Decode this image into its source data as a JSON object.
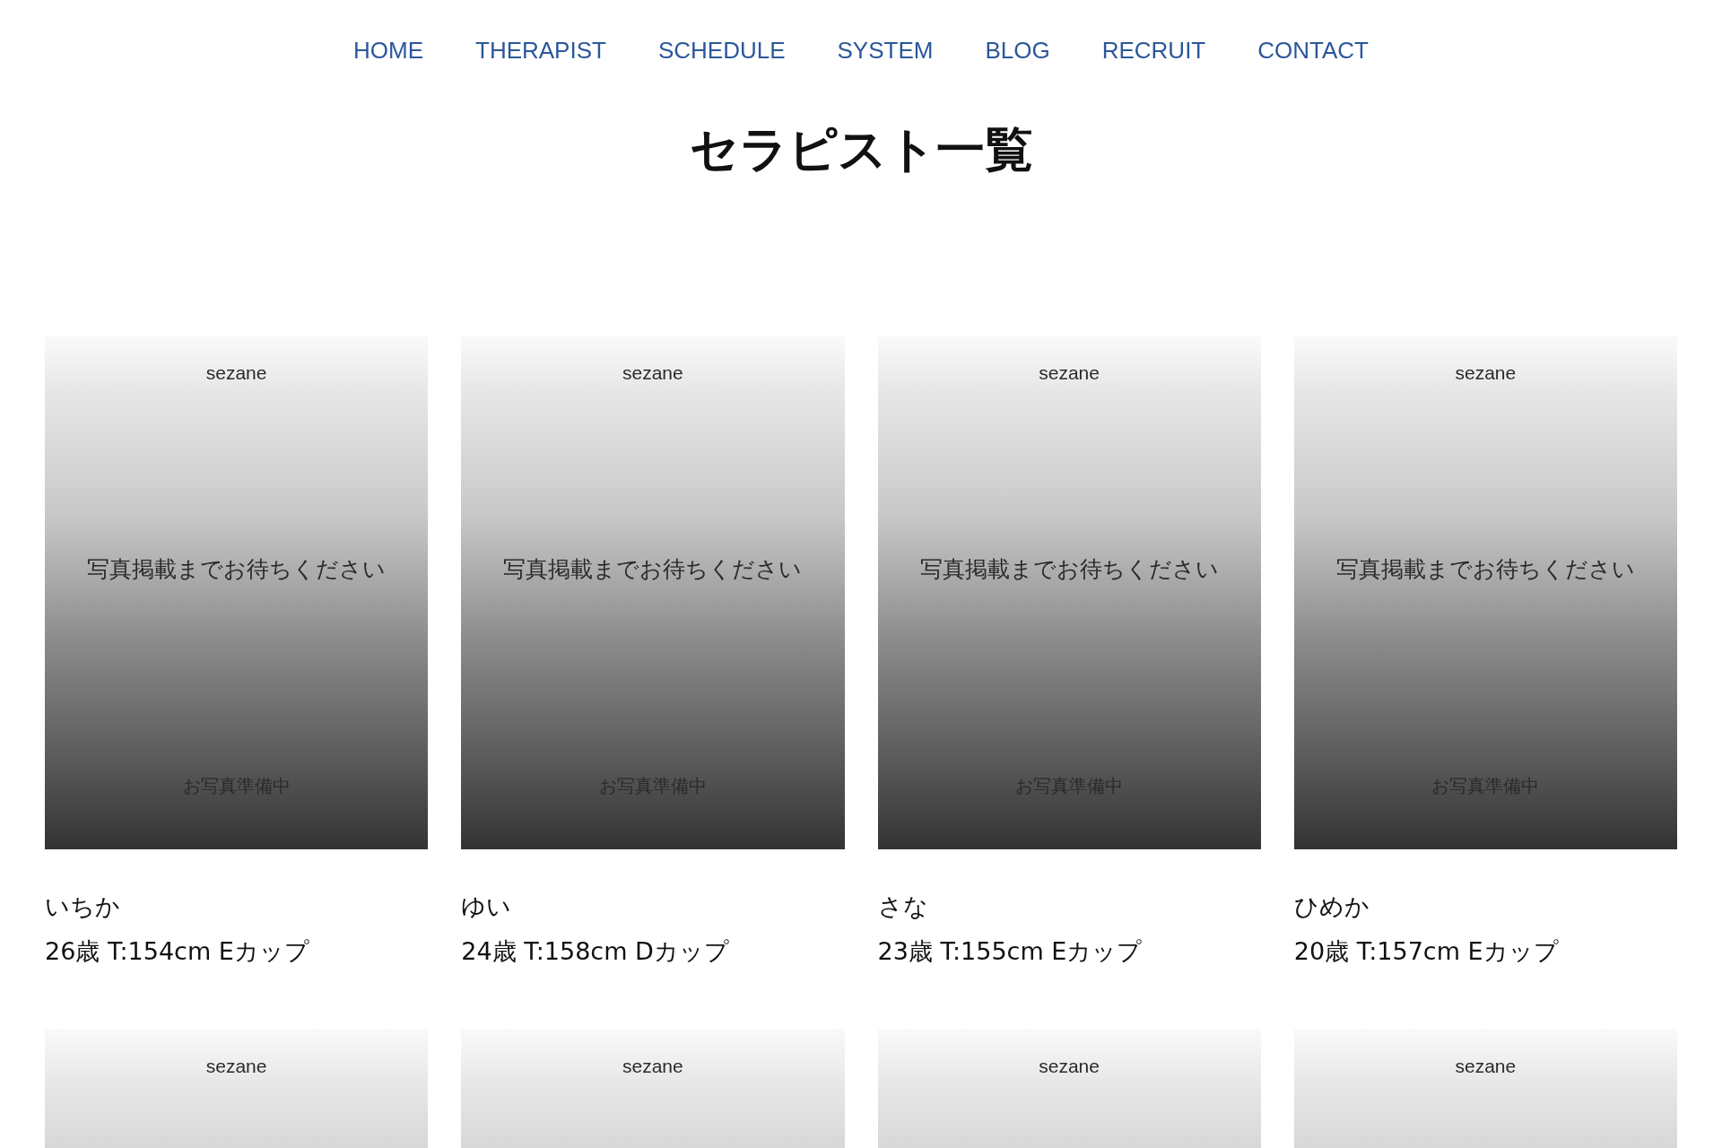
{
  "nav": [
    {
      "label": "HOME"
    },
    {
      "label": "THERAPIST"
    },
    {
      "label": "SCHEDULE"
    },
    {
      "label": "SYSTEM"
    },
    {
      "label": "BLOG"
    },
    {
      "label": "RECRUIT"
    },
    {
      "label": "CONTACT"
    }
  ],
  "page_title": "セラピスト一覧",
  "therapists": [
    {
      "photo": {
        "brand": "sezane",
        "message": "写真掲載までお待ちください",
        "note": "お写真準備中"
      },
      "name": "いちか",
      "details": "26歳 T:154cm Eカップ"
    },
    {
      "photo": {
        "brand": "sezane",
        "message": "写真掲載までお待ちください",
        "note": "お写真準備中"
      },
      "name": "ゆい",
      "details": "24歳 T:158cm Dカップ"
    },
    {
      "photo": {
        "brand": "sezane",
        "message": "写真掲載までお待ちください",
        "note": "お写真準備中"
      },
      "name": "さな",
      "details": "23歳 T:155cm Eカップ"
    },
    {
      "photo": {
        "brand": "sezane",
        "message": "写真掲載までお待ちください",
        "note": "お写真準備中"
      },
      "name": "ひめか",
      "details": "20歳 T:157cm Eカップ"
    },
    {
      "photo": {
        "brand": "sezane"
      }
    },
    {
      "photo": {
        "brand": "sezane"
      }
    },
    {
      "photo": {
        "brand": "sezane"
      }
    },
    {
      "photo": {
        "brand": "sezane"
      }
    }
  ]
}
